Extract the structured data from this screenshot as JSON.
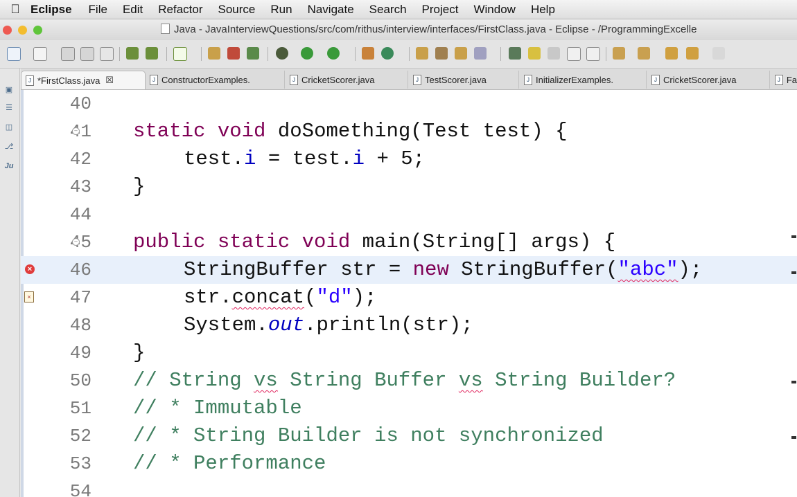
{
  "menubar": {
    "apple_icon": "apple-icon",
    "app_name": "Eclipse",
    "items": [
      "File",
      "Edit",
      "Refactor",
      "Source",
      "Run",
      "Navigate",
      "Search",
      "Project",
      "Window",
      "Help"
    ]
  },
  "titlebar": {
    "title": "Java - JavaInterviewQuestions/src/com/rithus/interview/interfaces/FirstClass.java - Eclipse - /ProgrammingExcelle",
    "lights": [
      "#ee5a52",
      "#f3bd2f",
      "#5fc53a"
    ]
  },
  "tabs": [
    {
      "label": "*FirstClass.java",
      "active": true
    },
    {
      "label": "ConstructorExamples.",
      "active": false
    },
    {
      "label": "CricketScorer.java",
      "active": false
    },
    {
      "label": "TestScorer.java",
      "active": false
    },
    {
      "label": "InitializerExamples.",
      "active": false
    },
    {
      "label": "CricketScorer.java",
      "active": false
    },
    {
      "label": "Fa",
      "active": false
    }
  ],
  "editor": {
    "current_line": "46",
    "lines": [
      {
        "num": "40"
      },
      {
        "num": "41"
      },
      {
        "num": "42"
      },
      {
        "num": "43"
      },
      {
        "num": "44"
      },
      {
        "num": "45"
      },
      {
        "num": "46"
      },
      {
        "num": "47"
      },
      {
        "num": "48"
      },
      {
        "num": "49"
      },
      {
        "num": "50"
      },
      {
        "num": "51"
      },
      {
        "num": "52"
      },
      {
        "num": "53"
      },
      {
        "num": "54"
      }
    ],
    "code": {
      "l41": {
        "kw1": "static",
        "kw2": "void",
        "rest": " doSomething(Test test) {"
      },
      "l42": {
        "a": "test.",
        "f1": "i",
        "b": " = test.",
        "f2": "i",
        "c": " + 5;"
      },
      "l43": "}",
      "l45": {
        "kw1": "public",
        "kw2": "static",
        "kw3": "void",
        "rest": " main(String[] args) {"
      },
      "l46": {
        "a": "StringBuffer str = ",
        "kw": "new",
        "b": " StringBuffer(",
        "s": "\"abc\"",
        "c": ");"
      },
      "l47": {
        "a": "str.",
        "m": "concat",
        "b": "(",
        "s": "\"d\"",
        "c": ");"
      },
      "l48": {
        "a": "System.",
        "f": "out",
        "b": ".println(str);"
      },
      "l49": "}",
      "l50": {
        "a": "// String ",
        "w1": "vs",
        "b": " String Buffer ",
        "w2": "vs",
        "c": " String Builder?"
      },
      "l51": "// * Immutable",
      "l52": "// * String Builder is not synchronized",
      "l53": "// * Performance"
    },
    "colors": {
      "keyword": "#7f0055",
      "field": "#0000c0",
      "string": "#2a00ff",
      "comment": "#3f7f5f"
    }
  }
}
